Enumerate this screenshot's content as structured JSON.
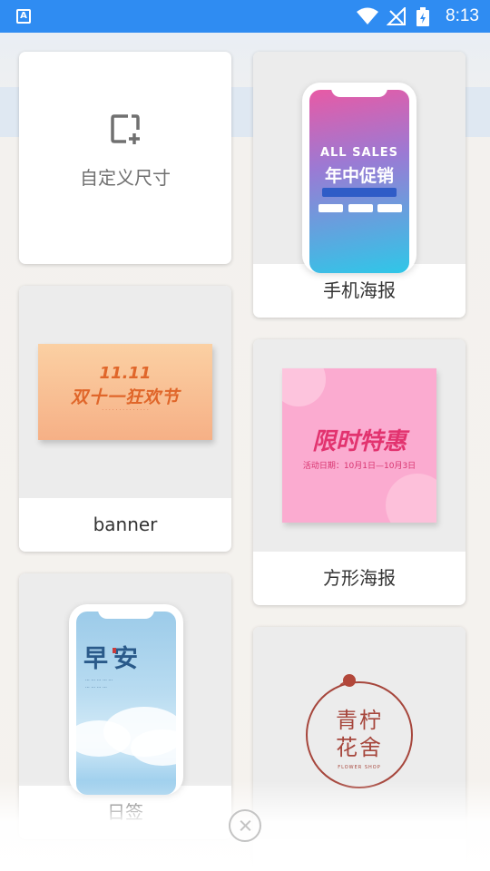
{
  "status_bar": {
    "time": "8:13",
    "icons": [
      "app-a-icon",
      "wifi-icon",
      "no-signal-icon",
      "battery-charging-icon"
    ],
    "accent": "#2f8cf2"
  },
  "templates": {
    "custom": {
      "label": "自定义尺寸",
      "icon": "add-canvas-icon"
    },
    "mobile_poster": {
      "label": "手机海报",
      "preview": {
        "headline_en": "ALL SALES",
        "headline_cn": "年中促销"
      }
    },
    "banner": {
      "label": "banner",
      "preview": {
        "date": "11.11",
        "headline": "双十一狂欢节"
      }
    },
    "square_poster": {
      "label": "方形海报",
      "preview": {
        "headline": "限时特惠",
        "subline": "活动日期：10月1日—10月3日"
      }
    },
    "daily_sign": {
      "label": "日签",
      "preview": {
        "headline": "早安"
      }
    },
    "flower_shop": {
      "preview": {
        "name_line1": "青柠",
        "name_line2": "花舍",
        "sub": "FLOWER SHOP"
      }
    }
  },
  "close_icon": "close-circle-icon"
}
